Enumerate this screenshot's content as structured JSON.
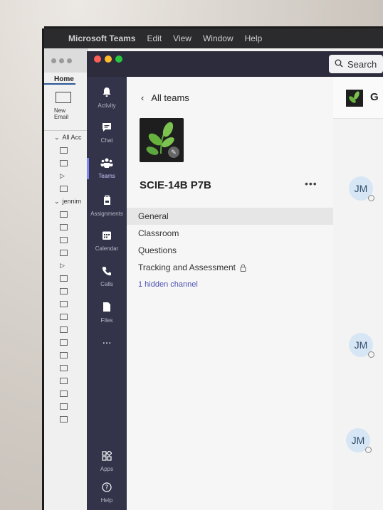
{
  "menubar": {
    "apple": "",
    "app_name": "Microsoft Teams",
    "items": [
      "Edit",
      "View",
      "Window",
      "Help"
    ]
  },
  "outlook": {
    "tab_home": "Home",
    "new_email": "New Email",
    "all_accounts": "All Acc",
    "account": "jennim"
  },
  "window": {
    "search_placeholder": "Search"
  },
  "rail": {
    "items": [
      {
        "label": "Activity",
        "icon": "bell-icon"
      },
      {
        "label": "Chat",
        "icon": "chat-icon"
      },
      {
        "label": "Teams",
        "icon": "teams-icon"
      },
      {
        "label": "Assignments",
        "icon": "assignments-icon"
      },
      {
        "label": "Calendar",
        "icon": "calendar-icon"
      },
      {
        "label": "Calls",
        "icon": "phone-icon"
      },
      {
        "label": "Files",
        "icon": "file-icon"
      },
      {
        "label": "...",
        "icon": "more-icon"
      },
      {
        "label": "Apps",
        "icon": "apps-icon"
      },
      {
        "label": "Help",
        "icon": "help-icon"
      }
    ]
  },
  "panel": {
    "back_label": "All teams",
    "team_name": "SCIE-14B P7B",
    "more_label": "•••",
    "channels": [
      {
        "name": "General",
        "selected": true
      },
      {
        "name": "Classroom"
      },
      {
        "name": "Questions"
      },
      {
        "name": "Tracking and Assessment",
        "locked": true
      }
    ],
    "hidden_channels": "1 hidden channel"
  },
  "chat": {
    "title_initial": "G",
    "avatar_initials": "JM"
  },
  "colors": {
    "rail_bg": "#33344a",
    "titlebar_bg": "#2d2c3c",
    "accent": "#7f85f5",
    "link": "#4f52b2"
  }
}
